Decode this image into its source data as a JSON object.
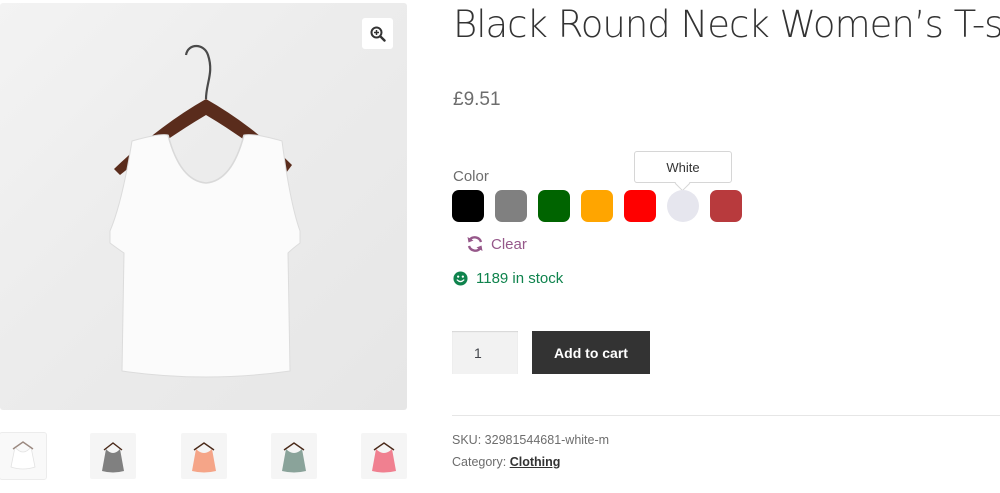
{
  "product": {
    "title": "Black Round Neck Women’s T-shirt",
    "price": "£9.51"
  },
  "variations": {
    "color_label": "Color",
    "tooltip": "White",
    "swatches": [
      {
        "name": "Black",
        "color": "#000000"
      },
      {
        "name": "Gray",
        "color": "#808080"
      },
      {
        "name": "Green",
        "color": "#006400"
      },
      {
        "name": "Orange",
        "color": "#ffa500"
      },
      {
        "name": "Red",
        "color": "#ff0000"
      },
      {
        "name": "White",
        "color": "#e6e6ee"
      },
      {
        "name": "Dark Red",
        "color": "#b83a3d"
      }
    ],
    "clear_label": "Clear"
  },
  "stock": {
    "label": "1189 in stock",
    "color": "#0f834d"
  },
  "cart": {
    "quantity": "1",
    "add_label": "Add to cart"
  },
  "meta": {
    "sku_label": "SKU:",
    "sku_value": "32981544681-white-m",
    "category_label": "Category:",
    "category_value": "Clothing"
  },
  "gallery": {
    "zoom_icon": "zoom-in-icon",
    "thumb_colors": [
      "#ffffff",
      "#808080",
      "#f5a588",
      "#8aa39a",
      "#f08090"
    ]
  },
  "colors": {
    "accent_link": "#96588a",
    "button_bg": "#333333"
  }
}
